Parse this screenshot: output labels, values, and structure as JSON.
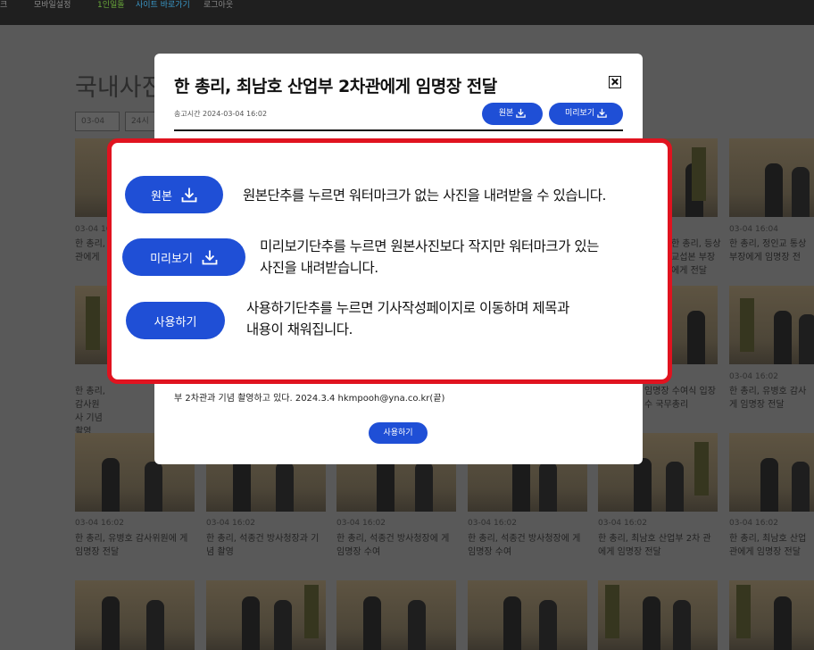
{
  "topnav": {
    "items": [
      "크",
      "모바일설정",
      "1인일돌",
      "사이트 바로가기",
      "로그아웃"
    ]
  },
  "background": {
    "title": "국내사진",
    "select_date": "03-04",
    "select_time": "24시",
    "grid": [
      {
        "date": "03-04 16",
        "text": "한 총리, 관에게"
      },
      {
        "date": "",
        "text": ""
      },
      {
        "date": "",
        "text": ""
      },
      {
        "date": "",
        "text": ""
      },
      {
        "date": "",
        "text": "한 총리, 등상교섭본 부장에게 전달"
      },
      {
        "date": "03-04 16:04",
        "text": "한 총리, 정인교 통상 부장에게 임명장 전"
      },
      {
        "date": "",
        "text": "한 총리, 감사원 사 기념 촬영"
      },
      {
        "date": "",
        "text": ""
      },
      {
        "date": "",
        "text": ""
      },
      {
        "date": "",
        "text": ""
      },
      {
        "date": "",
        "text": "임명장 수여식 입장 수 국무총리"
      },
      {
        "date": "03-04 16:02",
        "text": "한 총리, 유병호 감사 게 임명장 전달"
      },
      {
        "date": "03-04 16:02",
        "text": "한 총리, 유병호 감사위원에 게 임명장 전달"
      },
      {
        "date": "03-04 16:02",
        "text": "한 총리, 석종건 방사청장과 기념 촬영"
      },
      {
        "date": "03-04 16:02",
        "text": "한 총리, 석종건 방사청장에 게 임명장 수여"
      },
      {
        "date": "03-04 16:02",
        "text": "한 총리, 석종건 방사청장에 게 임명장 수여"
      },
      {
        "date": "03-04 16:02",
        "text": "한 총리, 최남호 산업부 2차 관에게 임명장 전달"
      },
      {
        "date": "03-04 16:02",
        "text": "한 총리, 최남호 산업 관에게 임명장 전달"
      }
    ],
    "grid_date_3_3": "03-04 16:02"
  },
  "modal": {
    "title": "한 총리, 최남호 산업부 2차관에게 임명장 전달",
    "sent_time": "송고시간 2024-03-04 16:02",
    "original_label": "원본",
    "preview_label": "미리보기",
    "caption": "부 2차관과 기념 촬영하고 있다. 2024.3.4 hkmpooh@yna.co.kr(끝)",
    "use_label": "사용하기"
  },
  "help": {
    "original_btn": "원본",
    "original_desc": "원본단추를 누르면 워터마크가 없는 사진을 내려받을 수 있습니다.",
    "preview_btn": "미리보기",
    "preview_desc_1": "미리보기단추를 누르면 원본사진보다 작지만 워터마크가 있는",
    "preview_desc_2": "사진을 내려받습니다.",
    "use_btn": "사용하기",
    "use_desc_1": "사용하기단추를 누르면 기사작성페이지로 이동하며 제목과",
    "use_desc_2": "내용이 채워집니다."
  },
  "colors": {
    "accent": "#1f4fd6",
    "highlight_border": "#e0131f",
    "overlay": "#595959"
  }
}
